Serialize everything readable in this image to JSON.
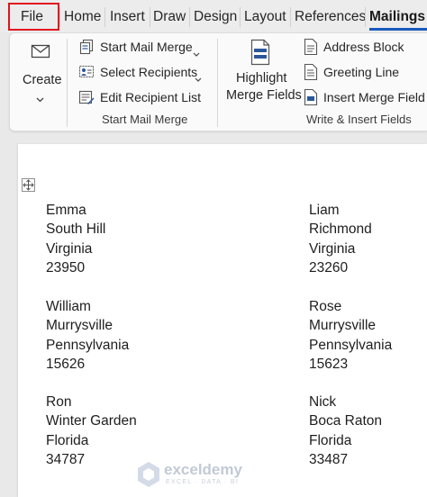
{
  "tabs": [
    {
      "label": "File"
    },
    {
      "label": "Home"
    },
    {
      "label": "Insert"
    },
    {
      "label": "Draw"
    },
    {
      "label": "Design"
    },
    {
      "label": "Layout"
    },
    {
      "label": "References"
    },
    {
      "label": "Mailings"
    }
  ],
  "active_tab": "Mailings",
  "ribbon": {
    "create": {
      "label": "Create"
    },
    "start_mail_merge_group": {
      "label": "Start Mail Merge",
      "buttons": [
        {
          "label": "Start Mail Merge"
        },
        {
          "label": "Select Recipients"
        },
        {
          "label": "Edit Recipient List"
        }
      ]
    },
    "write_insert_group": {
      "label": "Write & Insert Fields",
      "highlight_line1": "Highlight",
      "highlight_line2": "Merge Fields",
      "buttons": [
        {
          "label": "Address Block"
        },
        {
          "label": "Greeting Line"
        },
        {
          "label": "Insert Merge Field"
        }
      ]
    }
  },
  "labels": [
    {
      "name": "Emma",
      "city": "South Hill",
      "state": "Virginia",
      "zip": "23950"
    },
    {
      "name": "Liam",
      "city": "Richmond",
      "state": "Virginia",
      "zip": "23260"
    },
    {
      "name": "William",
      "city": "Murrysville",
      "state": "Pennsylvania",
      "zip": "15626"
    },
    {
      "name": "Rose",
      "city": "Murrysville",
      "state": "Pennsylvania",
      "zip": "15623"
    },
    {
      "name": "Ron",
      "city": "Winter Garden",
      "state": "Florida",
      "zip": "34787"
    },
    {
      "name": "Nick",
      "city": "Boca Raton",
      "state": "Florida",
      "zip": "33487"
    }
  ],
  "watermark": {
    "title": "exceldemy",
    "subtitle": "EXCEL · DATA · BI"
  },
  "colors": {
    "accent": "#185abd",
    "highlight_box": "#e0141e",
    "icon_blue": "#2b579a"
  }
}
